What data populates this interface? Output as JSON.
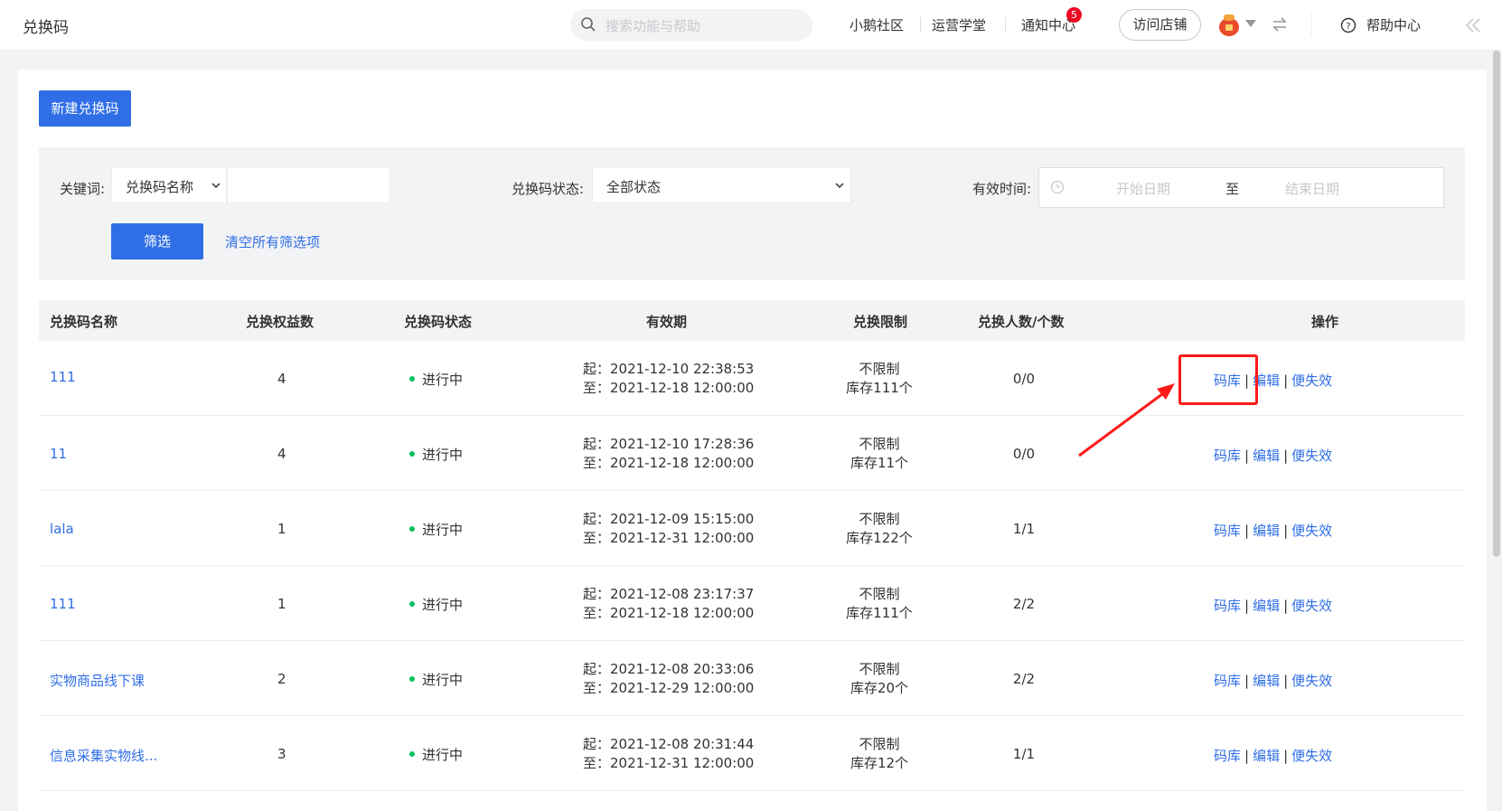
{
  "header": {
    "title": "兑换码",
    "search_placeholder": "搜索功能与帮助",
    "links": [
      "小鹅社区",
      "运营学堂",
      "通知中心"
    ],
    "notification_count": "5",
    "visit_store": "访问店铺",
    "help": "帮助中心"
  },
  "toolbar": {
    "new_button": "新建兑换码"
  },
  "filters": {
    "keyword_label": "关键词:",
    "keyword_type": "兑换码名称",
    "keyword_value": "",
    "status_label": "兑换码状态:",
    "status_value": "全部状态",
    "period_label": "有效时间:",
    "start_placeholder": "开始日期",
    "range_sep": "至",
    "end_placeholder": "结束日期",
    "filter_button": "筛选",
    "clear_link": "清空所有筛选项"
  },
  "table": {
    "headers": [
      "兑换码名称",
      "兑换权益数",
      "兑换码状态",
      "有效期",
      "兑换限制",
      "兑换人数/个数",
      "操作"
    ],
    "actions": {
      "library": "码库",
      "sep": "|",
      "edit": "编辑",
      "invalidate": "便失效"
    },
    "rows": [
      {
        "name": "111",
        "benefits": "4",
        "status": "进行中",
        "start": "起：2021-12-10 22:38:53",
        "end": "至：2021-12-18 12:00:00",
        "limit": "不限制",
        "stock": "库存111个",
        "count": "0/0"
      },
      {
        "name": "11",
        "benefits": "4",
        "status": "进行中",
        "start": "起：2021-12-10 17:28:36",
        "end": "至：2021-12-18 12:00:00",
        "limit": "不限制",
        "stock": "库存11个",
        "count": "0/0"
      },
      {
        "name": "lala",
        "benefits": "1",
        "status": "进行中",
        "start": "起：2021-12-09 15:15:00",
        "end": "至：2021-12-31 12:00:00",
        "limit": "不限制",
        "stock": "库存122个",
        "count": "1/1"
      },
      {
        "name": "111",
        "benefits": "1",
        "status": "进行中",
        "start": "起：2021-12-08 23:17:37",
        "end": "至：2021-12-18 12:00:00",
        "limit": "不限制",
        "stock": "库存111个",
        "count": "2/2"
      },
      {
        "name": "实物商品线下课",
        "benefits": "2",
        "status": "进行中",
        "start": "起：2021-12-08 20:33:06",
        "end": "至：2021-12-29 12:00:00",
        "limit": "不限制",
        "stock": "库存20个",
        "count": "2/2"
      },
      {
        "name": "信息采集实物线...",
        "benefits": "3",
        "status": "进行中",
        "start": "起：2021-12-08 20:31:44",
        "end": "至：2021-12-31 12:00:00",
        "limit": "不限制",
        "stock": "库存12个",
        "count": "1/1"
      }
    ]
  },
  "colors": {
    "primary": "#2f6ee6",
    "status_active": "#07c160",
    "annotation": "#ff1a1a"
  },
  "icons": [
    "search-icon",
    "avatar-icon",
    "caret-down-icon",
    "swap-icon",
    "help-icon",
    "collapse-icon",
    "chevron-down-icon",
    "clock-icon",
    "arrow-annotation"
  ]
}
